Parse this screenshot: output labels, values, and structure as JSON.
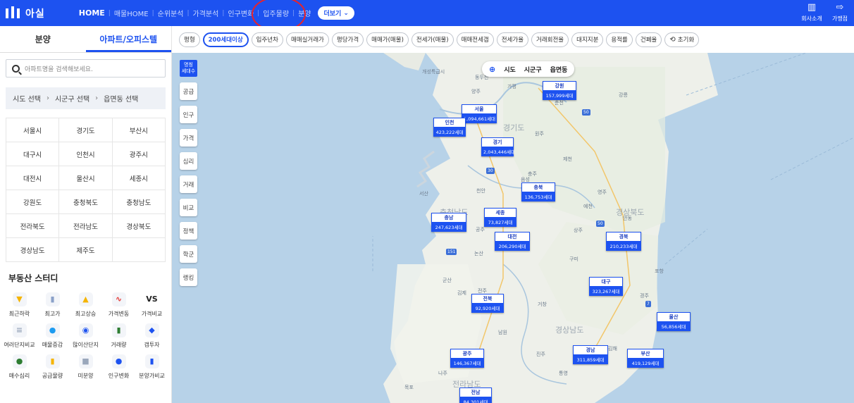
{
  "topbar": {
    "logo": "아실",
    "nav": [
      {
        "label": "HOME",
        "active": true
      },
      {
        "label": "매물HOME",
        "active": false
      },
      {
        "label": "순위분석",
        "active": false
      },
      {
        "label": "가격분석",
        "active": false
      },
      {
        "label": "인구변화",
        "active": false
      },
      {
        "label": "입주물량",
        "active": false
      },
      {
        "label": "분양",
        "active": false
      }
    ],
    "more_label": "더보기",
    "right": [
      {
        "label": "회사소개",
        "icon": "building-icon"
      },
      {
        "label": "가맹점",
        "icon": "login-icon"
      }
    ],
    "accent": "#1d52f0",
    "highlight_color": "#e8232a"
  },
  "sidebar": {
    "tabs": [
      {
        "label": "분양",
        "active": false
      },
      {
        "label": "아파트/오피스텔",
        "active": true
      }
    ],
    "search_placeholder": "아파트명을 검색해보세요.",
    "breadcrumb": [
      "시도 선택",
      "시군구 선택",
      "읍면동 선택"
    ],
    "regions": [
      "서울시",
      "경기도",
      "부산시",
      "대구시",
      "인천시",
      "광주시",
      "대전시",
      "울산시",
      "세종시",
      "강원도",
      "충청북도",
      "충청남도",
      "전라북도",
      "전라남도",
      "경상북도",
      "경상남도",
      "제주도",
      ""
    ],
    "study_title": "부동산 스터디",
    "study_items": [
      {
        "label": "최근하락",
        "icon": "chart-down-icon",
        "color": "#f5b400"
      },
      {
        "label": "최고가",
        "icon": "bar-chart-icon",
        "color": "#8aa0c8"
      },
      {
        "label": "최고상승",
        "icon": "chart-up-icon",
        "color": "#f5b400"
      },
      {
        "label": "가격변동",
        "icon": "pulse-icon",
        "color": "#e53935"
      },
      {
        "label": "가격비교",
        "icon": "vs-icon",
        "color": "#222"
      },
      {
        "label": "여러단지비교",
        "icon": "list-compare-icon",
        "color": "#9aa7bb"
      },
      {
        "label": "매물증감",
        "icon": "coins-icon",
        "color": "#1d9bf0"
      },
      {
        "label": "많이산단지",
        "icon": "location-pin-icon",
        "color": "#1d52f0"
      },
      {
        "label": "거래량",
        "icon": "volume-chart-icon",
        "color": "#2e7d32"
      },
      {
        "label": "갭투자",
        "icon": "gap-icon",
        "color": "#1d52f0"
      },
      {
        "label": "매수심리",
        "icon": "sentiment-icon",
        "color": "#2e7d32"
      },
      {
        "label": "공급물량",
        "icon": "supply-icon",
        "color": "#f5b400"
      },
      {
        "label": "미분양",
        "icon": "unsold-icon",
        "color": "#9aa7bb"
      },
      {
        "label": "인구변화",
        "icon": "people-icon",
        "color": "#1d52f0"
      },
      {
        "label": "분양가비교",
        "icon": "price-compare-icon",
        "color": "#1d52f0"
      }
    ]
  },
  "filters": {
    "chips": [
      {
        "label": "평형",
        "active": false
      },
      {
        "label": "200세대이상",
        "active": true
      },
      {
        "label": "입주년차",
        "active": false
      },
      {
        "label": "매매실거래가",
        "active": false
      },
      {
        "label": "평당가격",
        "active": false
      },
      {
        "label": "매매가(매물)",
        "active": false
      },
      {
        "label": "전세가(매물)",
        "active": false
      },
      {
        "label": "매매전세갭",
        "active": false
      },
      {
        "label": "전세가율",
        "active": false
      },
      {
        "label": "거래회전율",
        "active": false
      },
      {
        "label": "대지지분",
        "active": false
      },
      {
        "label": "용적률",
        "active": false
      },
      {
        "label": "건폐율",
        "active": false
      }
    ],
    "reset_label": "초기화"
  },
  "map": {
    "layer_menu": {
      "top": "명칭",
      "top_sub": "세대수",
      "items": [
        "공급",
        "인구",
        "가격",
        "심리",
        "거래",
        "비교",
        "정책",
        "학군",
        "랭킹"
      ]
    },
    "level_toggle": [
      "시도",
      "시군구",
      "읍면동"
    ],
    "markers": [
      {
        "name": "서울",
        "value": "1,094,661세대"
      },
      {
        "name": "인천",
        "value": "423,222세대"
      },
      {
        "name": "경기",
        "value": "2,043,446세대"
      },
      {
        "name": "강원",
        "value": "157,999세대"
      },
      {
        "name": "충북",
        "value": "136,753세대"
      },
      {
        "name": "충남",
        "value": "247,623세대"
      },
      {
        "name": "세종",
        "value": "73,827세대"
      },
      {
        "name": "대전",
        "value": "206,290세대"
      },
      {
        "name": "경북",
        "value": "210,233세대"
      },
      {
        "name": "대구",
        "value": "323,267세대"
      },
      {
        "name": "전북",
        "value": "92,920세대"
      },
      {
        "name": "울산",
        "value": "56,856세대"
      },
      {
        "name": "광주",
        "value": "146,367세대"
      },
      {
        "name": "경남",
        "value": "311,859세대"
      },
      {
        "name": "부산",
        "value": "419,129세대"
      },
      {
        "name": "전남",
        "value": "84,301세대"
      }
    ],
    "labels": [
      "개성특급시",
      "동두천",
      "가평",
      "양주",
      "춘천",
      "강릉",
      "서울",
      "인천",
      "경기도",
      "원주",
      "충주",
      "제천",
      "영주",
      "안동",
      "경상북도",
      "충청남도",
      "충청북도",
      "서산",
      "천안",
      "청주",
      "음성",
      "태안",
      "홍성",
      "공주",
      "보령",
      "논산",
      "김제",
      "군산",
      "익산",
      "전주",
      "남원",
      "거창",
      "구미",
      "김천",
      "상주",
      "문경",
      "예천",
      "포항",
      "경주",
      "경상남도",
      "진주",
      "창원",
      "김해",
      "양산",
      "사천",
      "통영",
      "목포",
      "나주",
      "전라남도",
      "함평"
    ]
  }
}
